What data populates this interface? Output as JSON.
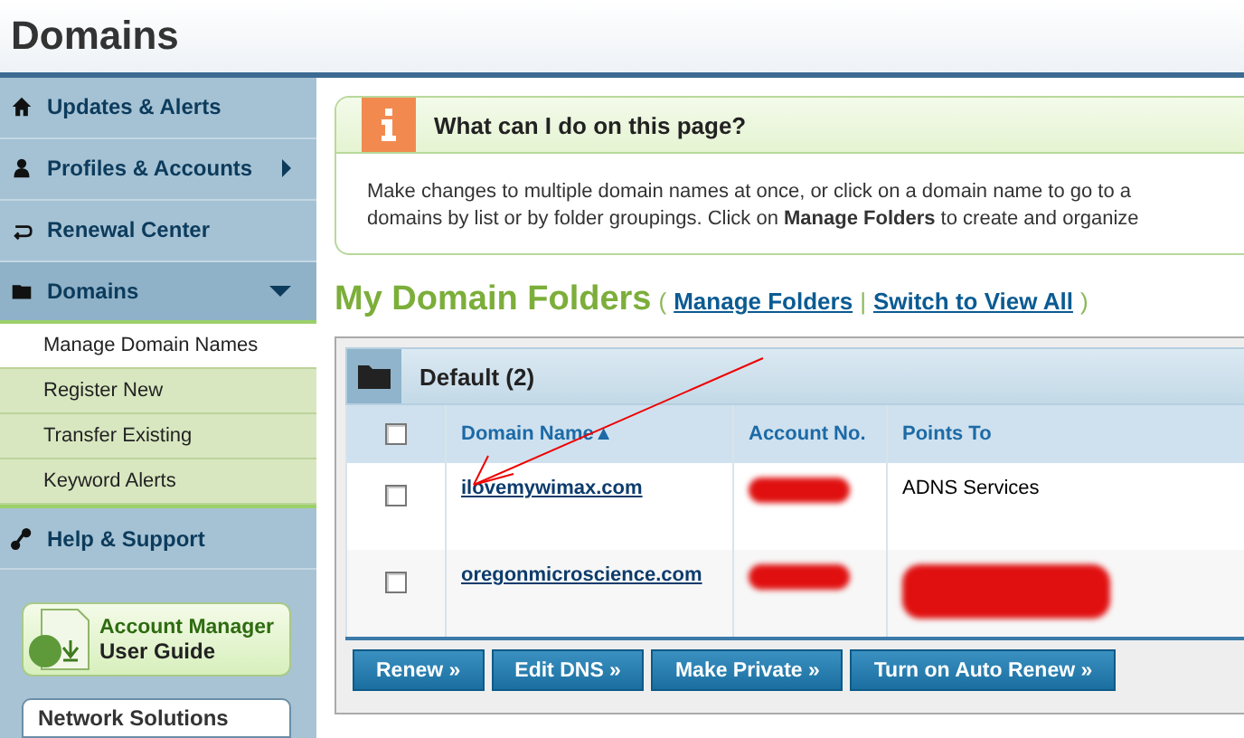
{
  "header": {
    "title": "Domains"
  },
  "sidebar": {
    "items": [
      {
        "label": "Updates & Alerts",
        "selected": false
      },
      {
        "label": "Profiles & Accounts",
        "selected": false,
        "expanded": false
      },
      {
        "label": "Renewal Center",
        "selected": false
      },
      {
        "label": "Domains",
        "selected": true,
        "expanded": true,
        "children": [
          {
            "label": "Manage Domain Names",
            "selected": true
          },
          {
            "label": "Register New",
            "selected": false
          },
          {
            "label": "Transfer Existing",
            "selected": false
          },
          {
            "label": "Keyword Alerts",
            "selected": false
          }
        ]
      },
      {
        "label": "Help & Support",
        "selected": false
      }
    ],
    "guide": {
      "line1": "Account Manager",
      "line2": "User Guide"
    },
    "brand_box": "Network Solutions"
  },
  "info": {
    "title": "What can I do on this page?",
    "lines": [
      "Make changes to multiple domain names at once, or click on a domain name to go to a",
      "domains by list or by folder groupings. Click on **Manage Folders** to create and organize"
    ]
  },
  "folders": {
    "title": "My Domain Folders",
    "links": [
      "Manage Folders",
      "Switch to View All"
    ],
    "open_paren": "(",
    "separator": "|",
    "close_paren": ")"
  },
  "folder": {
    "name": "Default (2)",
    "table": {
      "select_all_checked": false,
      "columns": [
        {
          "label": "Domain Name",
          "sort_mark": "▲"
        },
        {
          "label": "Account No."
        },
        {
          "label": "Points To"
        }
      ],
      "rows": [
        {
          "checked": false,
          "domain": "ilovemywimax.com",
          "points_to": "ADNS Services",
          "redacted_points": false
        },
        {
          "checked": false,
          "domain": "oregonmicroscience.com",
          "redacted_points": true
        }
      ]
    },
    "buttons": [
      "Renew »",
      "Edit DNS »",
      "Make Private »",
      "Turn on Auto Renew »"
    ]
  }
}
